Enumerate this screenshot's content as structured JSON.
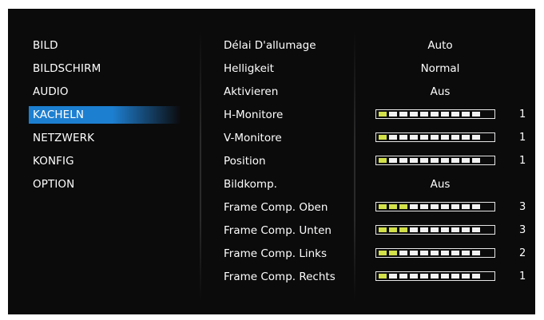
{
  "menu": {
    "items": [
      {
        "label": "BILD",
        "selected": false
      },
      {
        "label": "BILDSCHIRM",
        "selected": false
      },
      {
        "label": "AUDIO",
        "selected": false
      },
      {
        "label": "KACHELN",
        "selected": true
      },
      {
        "label": "NETZWERK",
        "selected": false
      },
      {
        "label": "KONFIG",
        "selected": false
      },
      {
        "label": "OPTION",
        "selected": false
      }
    ]
  },
  "settings": {
    "rows": [
      {
        "label": "Délai D'allumage",
        "value": "Auto"
      },
      {
        "label": "Helligkeit",
        "value": "Normal"
      },
      {
        "label": "Aktivieren",
        "value": "Aus"
      },
      {
        "label": "H-Monitore",
        "level": 1,
        "max": 10,
        "value_text": "1"
      },
      {
        "label": "V-Monitore",
        "level": 1,
        "max": 10,
        "value_text": "1"
      },
      {
        "label": "Position",
        "level": 1,
        "max": 10,
        "value_text": "1"
      },
      {
        "label": "Bildkomp.",
        "value": "Aus"
      },
      {
        "label": "Frame Comp. Oben",
        "level": 3,
        "max": 10,
        "value_text": "3"
      },
      {
        "label": "Frame Comp. Unten",
        "level": 3,
        "max": 10,
        "value_text": "3"
      },
      {
        "label": "Frame Comp. Links",
        "level": 2,
        "max": 10,
        "value_text": "2"
      },
      {
        "label": "Frame Comp. Rechts",
        "level": 1,
        "max": 10,
        "value_text": "1"
      }
    ]
  },
  "colors": {
    "selection": "#1d7fd0",
    "bar_active": "#d2e04a",
    "bar_inactive": "#f2f2f2",
    "background": "#0b0b0c"
  }
}
